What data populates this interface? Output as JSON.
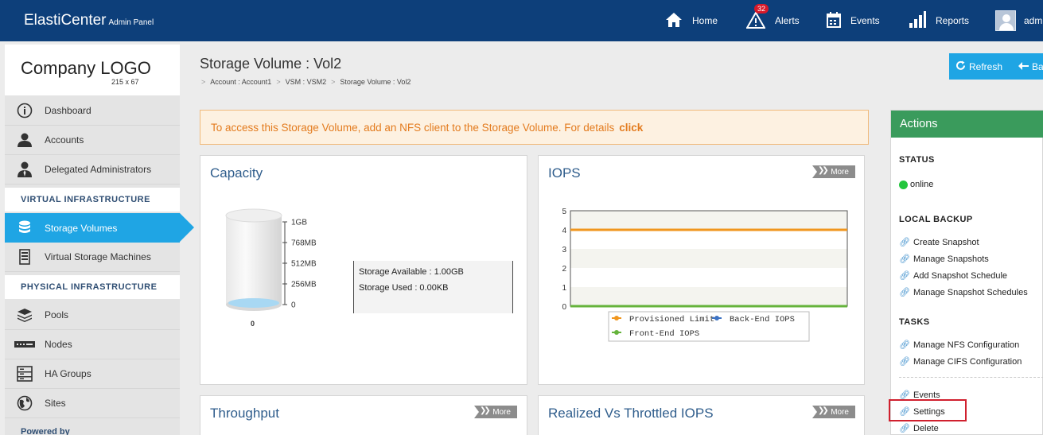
{
  "topbar": {
    "brand": "ElastiCenter",
    "brand_sub": "Admin Panel",
    "nav": [
      {
        "label": "Home",
        "icon": "home-icon"
      },
      {
        "label": "Alerts",
        "icon": "alert-icon",
        "badge": "32"
      },
      {
        "label": "Events",
        "icon": "calendar-icon"
      },
      {
        "label": "Reports",
        "icon": "bar-chart-icon"
      },
      {
        "label": "admin",
        "icon": "avatar"
      }
    ]
  },
  "sidebar": {
    "logo": "Company LOGO",
    "logo_size": "215 x 67",
    "items_top": [
      {
        "label": "Dashboard",
        "icon": "info-icon"
      },
      {
        "label": "Accounts",
        "icon": "user-icon"
      },
      {
        "label": "Delegated Administrators",
        "icon": "admin-icon"
      }
    ],
    "section_virtual": "VIRTUAL INFRASTRUCTURE",
    "items_virtual": [
      {
        "label": "Storage Volumes",
        "icon": "database-icon",
        "active": true
      },
      {
        "label": "Virtual Storage Machines",
        "icon": "vsm-icon"
      }
    ],
    "section_physical": "PHYSICAL INFRASTRUCTURE",
    "items_physical": [
      {
        "label": "Pools",
        "icon": "layers-icon"
      },
      {
        "label": "Nodes",
        "icon": "node-icon"
      },
      {
        "label": "HA Groups",
        "icon": "server-icon"
      },
      {
        "label": "Sites",
        "icon": "globe-icon"
      }
    ],
    "powered_by": "Powered by"
  },
  "main": {
    "title": "Storage Volume : Vol2",
    "breadcrumbs": [
      "Account : Account1",
      "VSM : VSM2",
      "Storage Volume : Vol2"
    ],
    "refresh_label": "Refresh",
    "back_label": "Back",
    "alert_text": "To access this Storage Volume, add an NFS client to the Storage Volume. For details",
    "alert_link": "click"
  },
  "panels": {
    "capacity": {
      "title": "Capacity",
      "ticks": [
        "1GB",
        "768MB",
        "512MB",
        "256MB",
        "0"
      ],
      "cylinder_label": "0",
      "available": "Storage Available : 1.00GB",
      "used": "Storage Used : 0.00KB"
    },
    "iops": {
      "title": "IOPS",
      "more": "More"
    },
    "throughput": {
      "title": "Throughput",
      "more": "More"
    },
    "realized": {
      "title": "Realized Vs Throttled IOPS",
      "more": "More"
    }
  },
  "chart_data": {
    "type": "line",
    "title": "IOPS",
    "y_ticks": [
      0,
      1,
      2,
      3,
      4,
      5
    ],
    "ylim": [
      0,
      5
    ],
    "series": [
      {
        "name": "Provisioned Limit",
        "value": 4,
        "color": "#f0961e"
      },
      {
        "name": "Back-End IOPS",
        "value": 0,
        "color": "#3d73c4"
      },
      {
        "name": "Front-End IOPS",
        "value": 0,
        "color": "#65b33b"
      }
    ],
    "legend": "bottom"
  },
  "actions": {
    "title": "Actions",
    "status_head": "STATUS",
    "status": "online",
    "local_backup_head": "LOCAL BACKUP",
    "local_backup": [
      "Create Snapshot",
      "Manage Snapshots",
      "Add Snapshot Schedule",
      "Manage Snapshot Schedules"
    ],
    "tasks_head": "TASKS",
    "tasks": [
      "Manage NFS Configuration",
      "Manage CIFS Configuration"
    ],
    "other": [
      "Events",
      "Settings",
      "Delete"
    ]
  }
}
